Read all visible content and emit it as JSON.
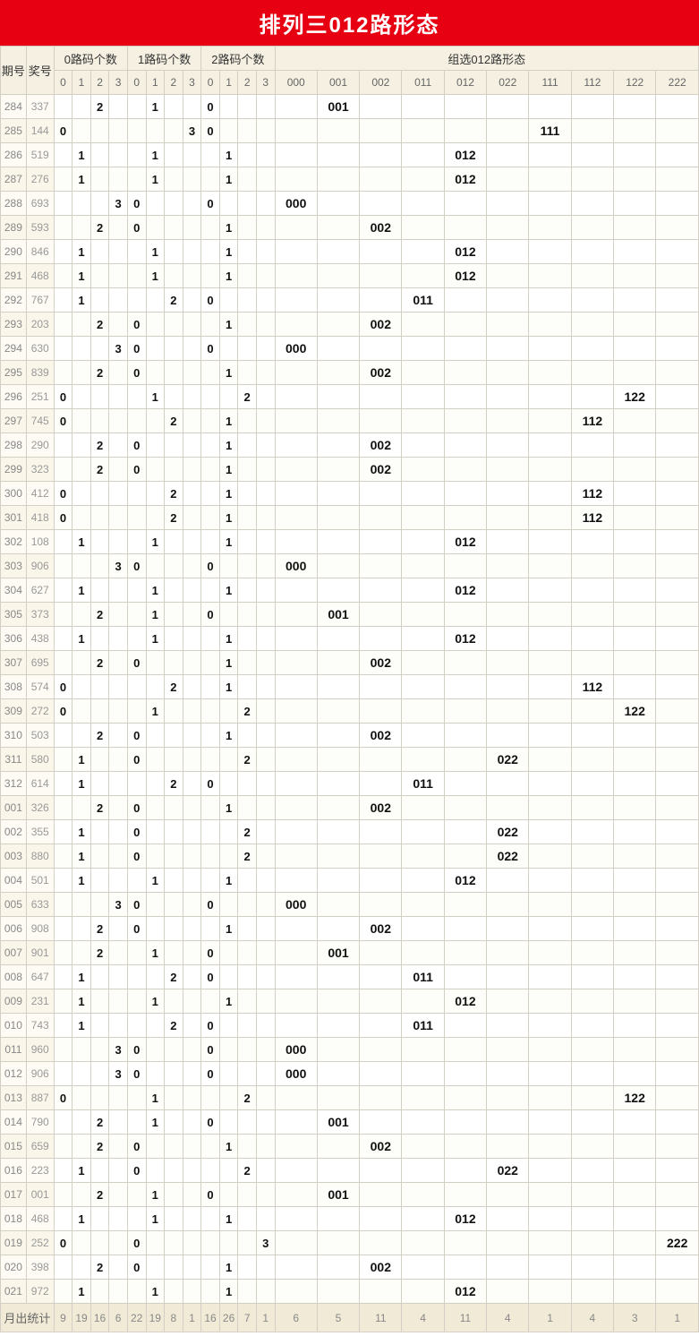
{
  "title": "排列三012路形态",
  "headers": {
    "period": "期号",
    "prize": "奖号",
    "g0": "0路码个数",
    "g1": "1路码个数",
    "g2": "2路码个数",
    "gpat": "组选012路形态",
    "sub": [
      "0",
      "1",
      "2",
      "3"
    ],
    "pats": [
      "000",
      "001",
      "002",
      "011",
      "012",
      "022",
      "111",
      "112",
      "122",
      "222"
    ]
  },
  "summary_label": "月出统计",
  "summary": [
    9,
    19,
    16,
    6,
    22,
    19,
    8,
    1,
    16,
    26,
    7,
    1,
    6,
    5,
    11,
    4,
    11,
    4,
    1,
    4,
    3,
    1
  ],
  "chart_data": {
    "type": "table",
    "title": "排列三012路形态",
    "rows": [
      {
        "period": "284",
        "num": "337",
        "c0": 2,
        "c1": 1,
        "c2": 0,
        "pat": "001"
      },
      {
        "period": "285",
        "num": "144",
        "c0": 0,
        "c1": 3,
        "c2": 0,
        "pat": "111"
      },
      {
        "period": "286",
        "num": "519",
        "c0": 1,
        "c1": 1,
        "c2": 1,
        "pat": "012"
      },
      {
        "period": "287",
        "num": "276",
        "c0": 1,
        "c1": 1,
        "c2": 1,
        "pat": "012"
      },
      {
        "period": "288",
        "num": "693",
        "c0": 3,
        "c1": 0,
        "c2": 0,
        "pat": "000"
      },
      {
        "period": "289",
        "num": "593",
        "c0": 2,
        "c1": 0,
        "c2": 1,
        "pat": "002"
      },
      {
        "period": "290",
        "num": "846",
        "c0": 1,
        "c1": 1,
        "c2": 1,
        "pat": "012"
      },
      {
        "period": "291",
        "num": "468",
        "c0": 1,
        "c1": 1,
        "c2": 1,
        "pat": "012"
      },
      {
        "period": "292",
        "num": "767",
        "c0": 1,
        "c1": 2,
        "c2": 0,
        "pat": "011"
      },
      {
        "period": "293",
        "num": "203",
        "c0": 2,
        "c1": 0,
        "c2": 1,
        "pat": "002"
      },
      {
        "period": "294",
        "num": "630",
        "c0": 3,
        "c1": 0,
        "c2": 0,
        "pat": "000"
      },
      {
        "period": "295",
        "num": "839",
        "c0": 2,
        "c1": 0,
        "c2": 1,
        "pat": "002"
      },
      {
        "period": "296",
        "num": "251",
        "c0": 0,
        "c1": 1,
        "c2": 2,
        "pat": "122"
      },
      {
        "period": "297",
        "num": "745",
        "c0": 0,
        "c1": 2,
        "c2": 1,
        "pat": "112"
      },
      {
        "period": "298",
        "num": "290",
        "c0": 2,
        "c1": 0,
        "c2": 1,
        "pat": "002"
      },
      {
        "period": "299",
        "num": "323",
        "c0": 2,
        "c1": 0,
        "c2": 1,
        "pat": "002"
      },
      {
        "period": "300",
        "num": "412",
        "c0": 0,
        "c1": 2,
        "c2": 1,
        "pat": "112"
      },
      {
        "period": "301",
        "num": "418",
        "c0": 0,
        "c1": 2,
        "c2": 1,
        "pat": "112"
      },
      {
        "period": "302",
        "num": "108",
        "c0": 1,
        "c1": 1,
        "c2": 1,
        "pat": "012"
      },
      {
        "period": "303",
        "num": "906",
        "c0": 3,
        "c1": 0,
        "c2": 0,
        "pat": "000"
      },
      {
        "period": "304",
        "num": "627",
        "c0": 1,
        "c1": 1,
        "c2": 1,
        "pat": "012"
      },
      {
        "period": "305",
        "num": "373",
        "c0": 2,
        "c1": 1,
        "c2": 0,
        "pat": "001"
      },
      {
        "period": "306",
        "num": "438",
        "c0": 1,
        "c1": 1,
        "c2": 1,
        "pat": "012"
      },
      {
        "period": "307",
        "num": "695",
        "c0": 2,
        "c1": 0,
        "c2": 1,
        "pat": "002"
      },
      {
        "period": "308",
        "num": "574",
        "c0": 0,
        "c1": 2,
        "c2": 1,
        "pat": "112"
      },
      {
        "period": "309",
        "num": "272",
        "c0": 0,
        "c1": 1,
        "c2": 2,
        "pat": "122"
      },
      {
        "period": "310",
        "num": "503",
        "c0": 2,
        "c1": 0,
        "c2": 1,
        "pat": "002"
      },
      {
        "period": "311",
        "num": "580",
        "c0": 1,
        "c1": 0,
        "c2": 2,
        "pat": "022"
      },
      {
        "period": "312",
        "num": "614",
        "c0": 1,
        "c1": 2,
        "c2": 0,
        "pat": "011"
      },
      {
        "period": "001",
        "num": "326",
        "c0": 2,
        "c1": 0,
        "c2": 1,
        "pat": "002"
      },
      {
        "period": "002",
        "num": "355",
        "c0": 1,
        "c1": 0,
        "c2": 2,
        "pat": "022"
      },
      {
        "period": "003",
        "num": "880",
        "c0": 1,
        "c1": 0,
        "c2": 2,
        "pat": "022"
      },
      {
        "period": "004",
        "num": "501",
        "c0": 1,
        "c1": 1,
        "c2": 1,
        "pat": "012"
      },
      {
        "period": "005",
        "num": "633",
        "c0": 3,
        "c1": 0,
        "c2": 0,
        "pat": "000"
      },
      {
        "period": "006",
        "num": "908",
        "c0": 2,
        "c1": 0,
        "c2": 1,
        "pat": "002"
      },
      {
        "period": "007",
        "num": "901",
        "c0": 2,
        "c1": 1,
        "c2": 0,
        "pat": "001"
      },
      {
        "period": "008",
        "num": "647",
        "c0": 1,
        "c1": 2,
        "c2": 0,
        "pat": "011"
      },
      {
        "period": "009",
        "num": "231",
        "c0": 1,
        "c1": 1,
        "c2": 1,
        "pat": "012"
      },
      {
        "period": "010",
        "num": "743",
        "c0": 1,
        "c1": 2,
        "c2": 0,
        "pat": "011"
      },
      {
        "period": "011",
        "num": "960",
        "c0": 3,
        "c1": 0,
        "c2": 0,
        "pat": "000"
      },
      {
        "period": "012",
        "num": "906",
        "c0": 3,
        "c1": 0,
        "c2": 0,
        "pat": "000"
      },
      {
        "period": "013",
        "num": "887",
        "c0": 0,
        "c1": 1,
        "c2": 2,
        "pat": "122"
      },
      {
        "period": "014",
        "num": "790",
        "c0": 2,
        "c1": 1,
        "c2": 0,
        "pat": "001"
      },
      {
        "period": "015",
        "num": "659",
        "c0": 2,
        "c1": 0,
        "c2": 1,
        "pat": "002"
      },
      {
        "period": "016",
        "num": "223",
        "c0": 1,
        "c1": 0,
        "c2": 2,
        "pat": "022"
      },
      {
        "period": "017",
        "num": "001",
        "c0": 2,
        "c1": 1,
        "c2": 0,
        "pat": "001"
      },
      {
        "period": "018",
        "num": "468",
        "c0": 1,
        "c1": 1,
        "c2": 1,
        "pat": "012"
      },
      {
        "period": "019",
        "num": "252",
        "c0": 0,
        "c1": 0,
        "c2": 3,
        "pat": "222"
      },
      {
        "period": "020",
        "num": "398",
        "c0": 2,
        "c1": 0,
        "c2": 1,
        "pat": "002"
      },
      {
        "period": "021",
        "num": "972",
        "c0": 1,
        "c1": 1,
        "c2": 1,
        "pat": "012"
      }
    ]
  }
}
